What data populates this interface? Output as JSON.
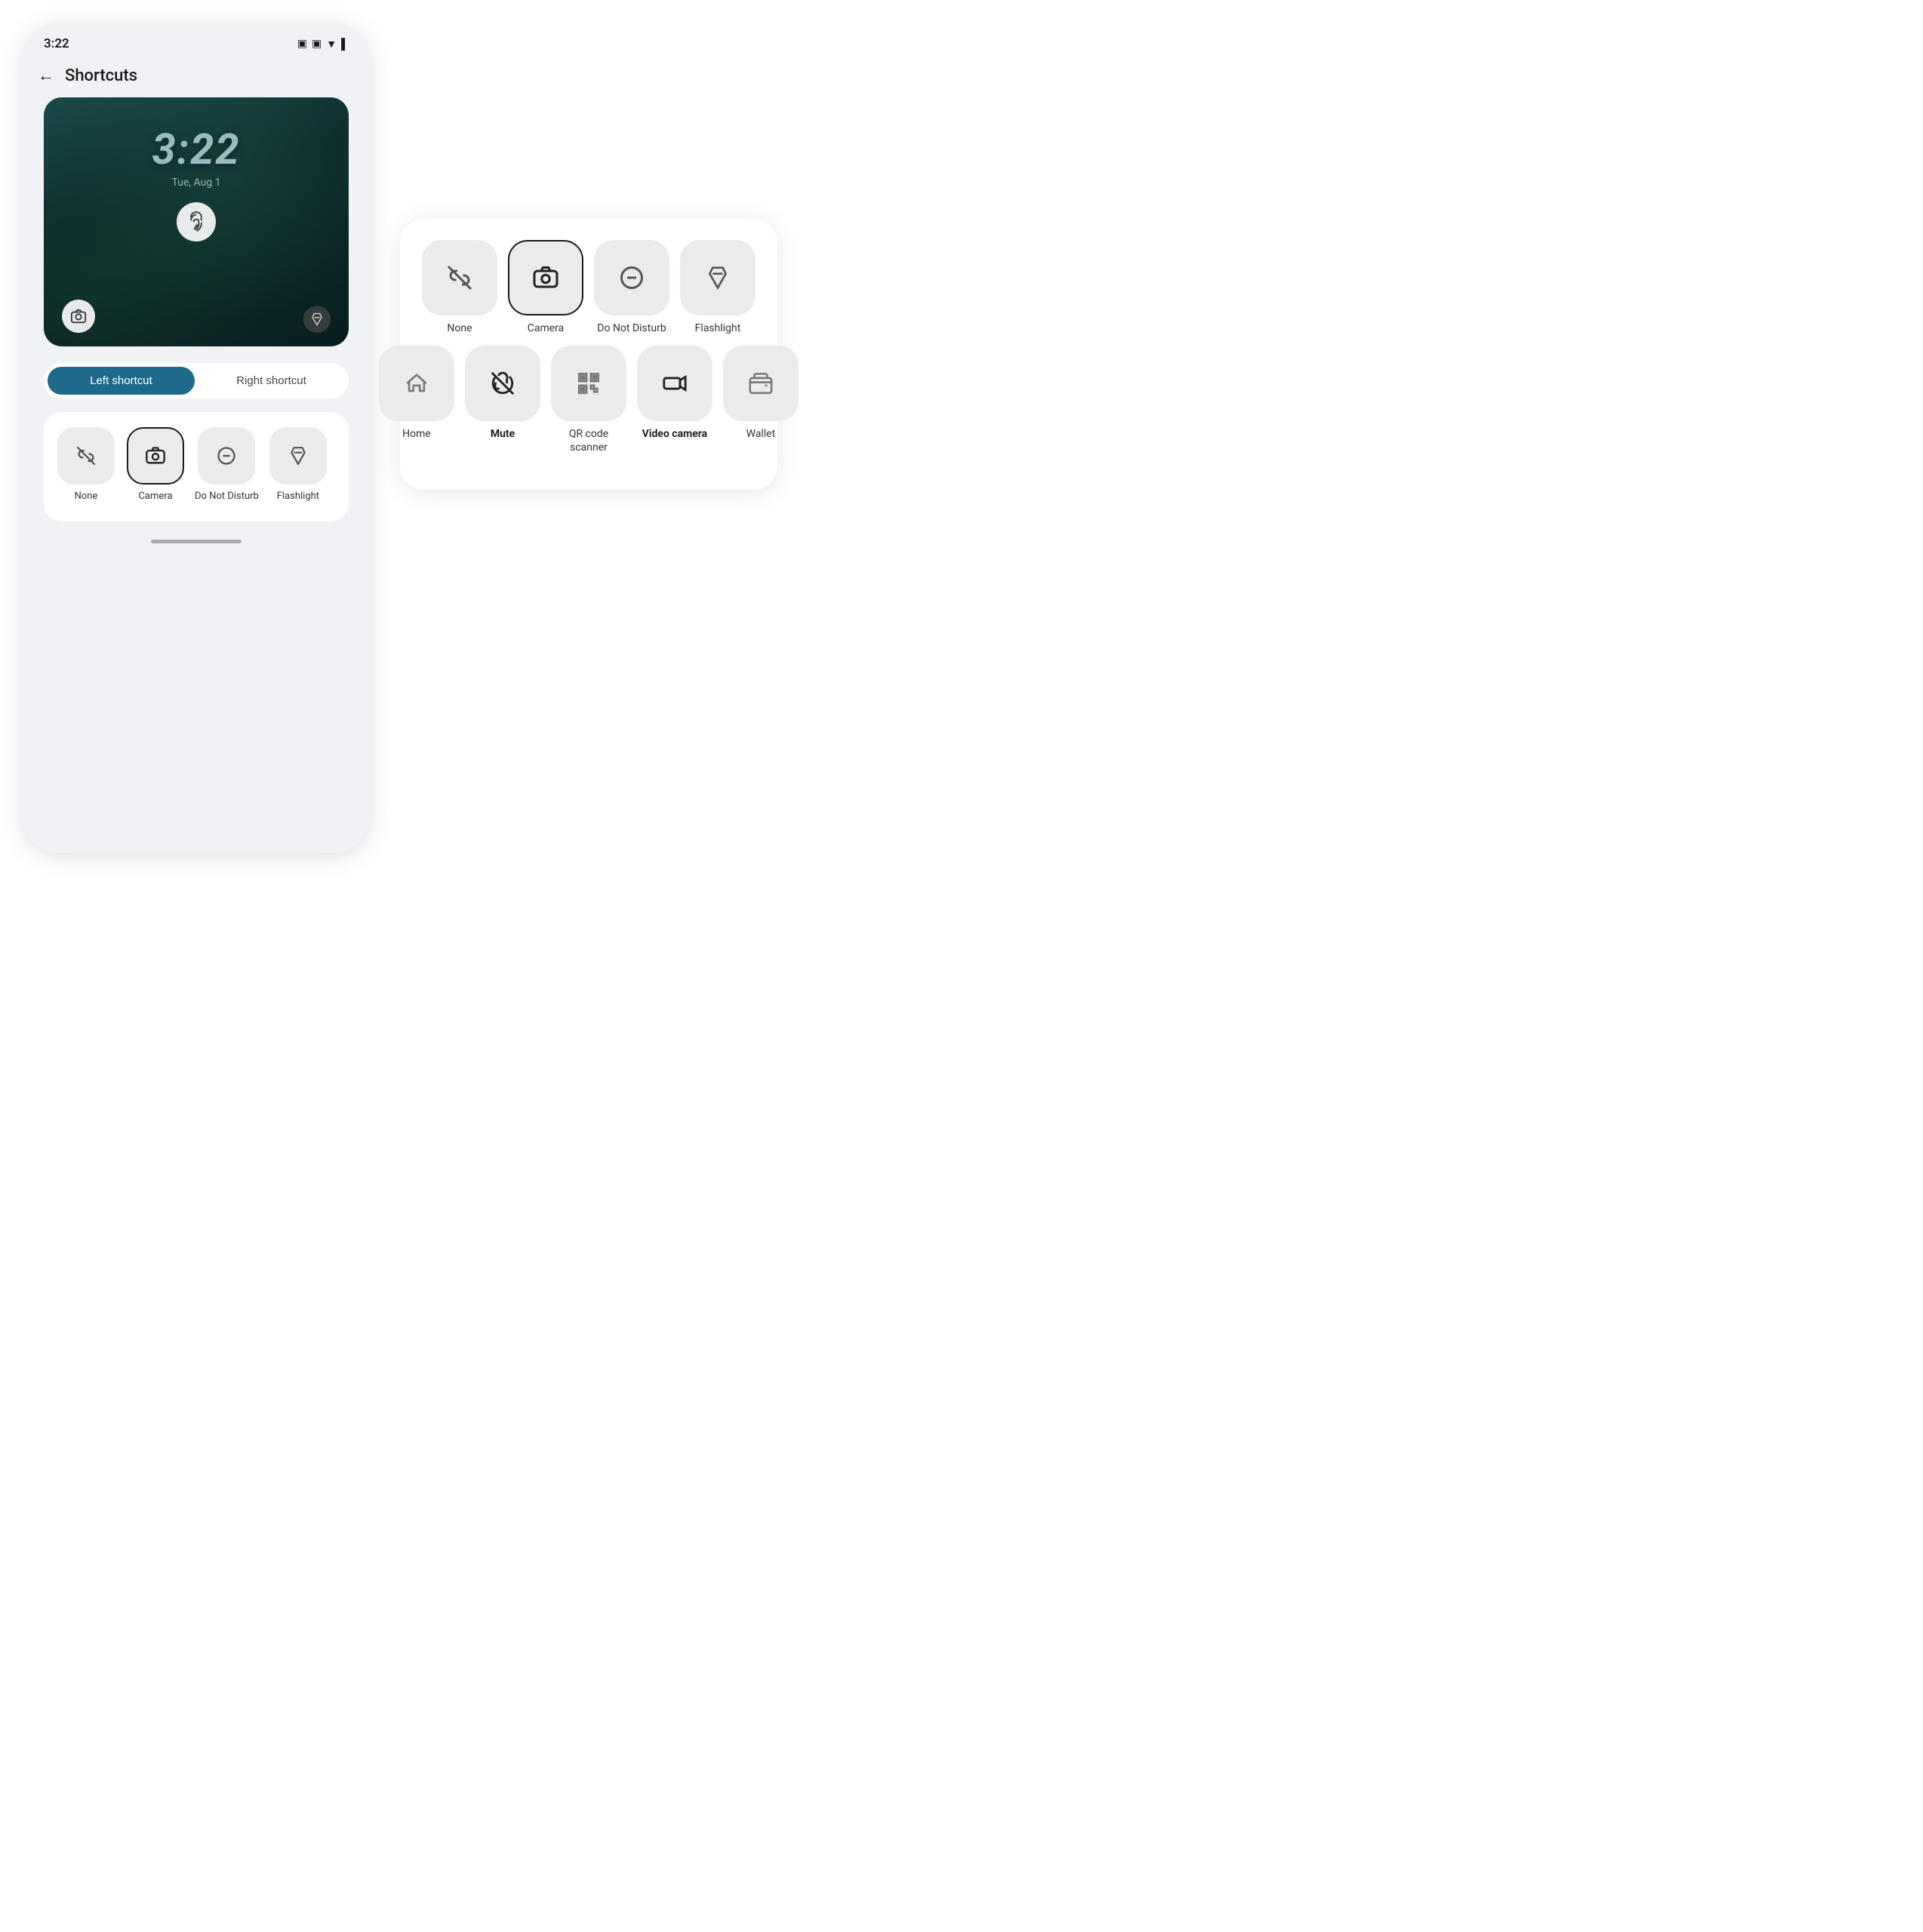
{
  "statusBar": {
    "time": "3:22",
    "icons": [
      "📶",
      "🔋"
    ]
  },
  "header": {
    "backLabel": "←",
    "title": "Shortcuts"
  },
  "lockscreen": {
    "time": "3:22",
    "date": "Tue, Aug 1"
  },
  "tabs": {
    "left": "Left shortcut",
    "right": "Right shortcut",
    "activeTab": "left"
  },
  "shortcutGrid": {
    "items": [
      {
        "id": "none",
        "label": "None",
        "icon": "none"
      },
      {
        "id": "camera",
        "label": "Camera",
        "icon": "camera",
        "selected": true
      },
      {
        "id": "donotdisturb",
        "label": "Do Not Disturb",
        "icon": "dnd"
      },
      {
        "id": "flashlight",
        "label": "Flashlight",
        "icon": "flashlight"
      }
    ]
  },
  "popup": {
    "row1": [
      {
        "id": "none",
        "label": "None",
        "icon": "none"
      },
      {
        "id": "camera",
        "label": "Camera",
        "icon": "camera",
        "selected": true
      },
      {
        "id": "donotdisturb",
        "label": "Do Not Disturb",
        "icon": "dnd"
      },
      {
        "id": "flashlight",
        "label": "Flashlight",
        "icon": "flashlight"
      }
    ],
    "row2": [
      {
        "id": "home",
        "label": "Home",
        "icon": "home"
      },
      {
        "id": "mute",
        "label": "Mute",
        "icon": "mute",
        "bold": true
      },
      {
        "id": "qr",
        "label": "QR code scanner",
        "icon": "qr"
      },
      {
        "id": "videocamera",
        "label": "Video camera",
        "icon": "videocam",
        "bold": true
      },
      {
        "id": "wallet",
        "label": "Wallet",
        "icon": "wallet"
      }
    ]
  }
}
